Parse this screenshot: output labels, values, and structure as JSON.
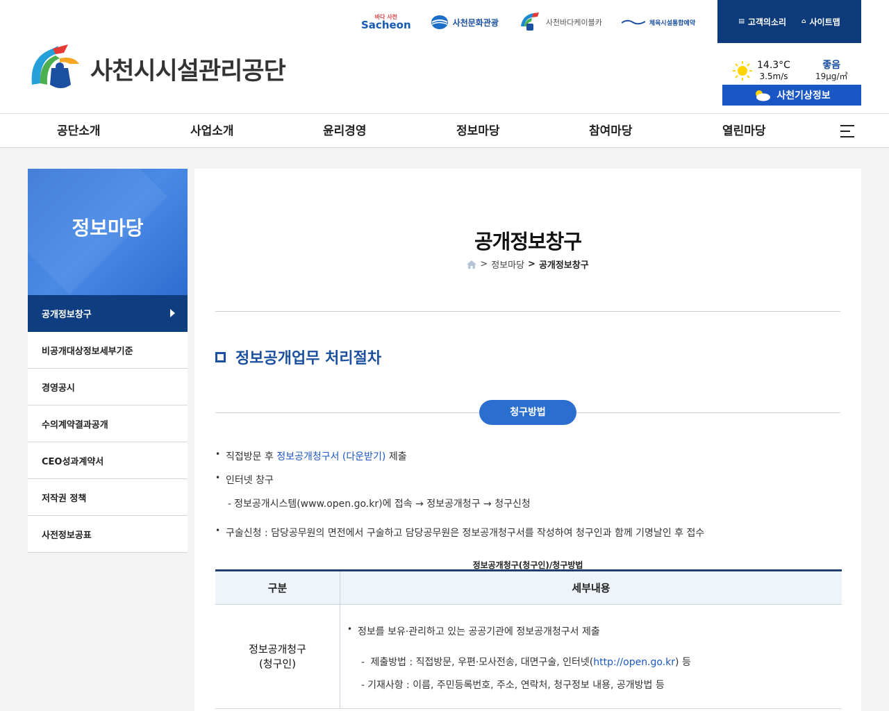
{
  "header": {
    "family_links": {
      "sacheon_sub": "바다 사천",
      "sacheon": "Sacheon",
      "culture": "사천문화관광",
      "cable_car": "사천바다케이블카",
      "sports": "체육시설통합예약"
    },
    "util": {
      "voice": "고객의소리",
      "sitemap": "사이트맵"
    },
    "logo_text": "사천시시설관리공단",
    "weather": {
      "temp": "14.3°C",
      "wind": "3.5m/s",
      "air_status": "좋음",
      "air_value": "19μg/㎥",
      "button": "사천기상정보"
    }
  },
  "nav": {
    "items": [
      "공단소개",
      "사업소개",
      "윤리경영",
      "정보마당",
      "참여마당",
      "열린마당"
    ]
  },
  "sidebar": {
    "title": "정보마당",
    "items": [
      {
        "label": "공개정보창구"
      },
      {
        "label": "비공개대상정보세부기준"
      },
      {
        "label": "경영공시"
      },
      {
        "label": "수의계약결과공개"
      },
      {
        "label": "CEO성과계약서"
      },
      {
        "label": "저작권 정책"
      },
      {
        "label": "사전정보공표"
      }
    ]
  },
  "content": {
    "page_title": "공개정보창구",
    "breadcrumb": {
      "sep1": ">",
      "level1": "정보마당",
      "sep2": ">",
      "current": "공개정보창구"
    },
    "section_title": "정보공개업무 처리절차",
    "pill": "청구방법",
    "bullet1_prefix": "직접방문 후",
    "bullet1_link": "정보공개청구서 (다운받기)",
    "bullet1_suffix": "제출",
    "bullet2": "인터넷 창구",
    "bullet2_sub": "정보공개시스템(www.open.go.kr)에 접속 → 정보공개청구 → 청구신청",
    "bullet3": "구술신청 : 담당공무원의 면전에서 구술하고 담당공무원은 정보공개청구서를 작성하여 청구인과 함께 기명날인 후 접수",
    "table": {
      "caption": "정보공개청구(청구인)/청구방법",
      "headers": [
        "구분",
        "세부내용"
      ],
      "row1": {
        "label_line1": "정보공개청구",
        "label_line2": "(청구인)",
        "bullet": "정보를 보유·관리하고 있는 공공기관에 정보공개청구서 제출",
        "sub1_prefix": "제출방법 : 직접방문, 우편·모사전송, 대면구술, 인터넷(",
        "sub1_link": "http://open.go.kr",
        "sub1_suffix": ") 등",
        "sub2": "기재사항 : 이름, 주민등록번호, 주소, 연락처, 청구정보 내용, 공개방법 등"
      }
    }
  },
  "colors": {
    "navy": "#0e3d80",
    "brand_blue": "#1b4fa0",
    "accent_blue": "#2a6fd0"
  }
}
